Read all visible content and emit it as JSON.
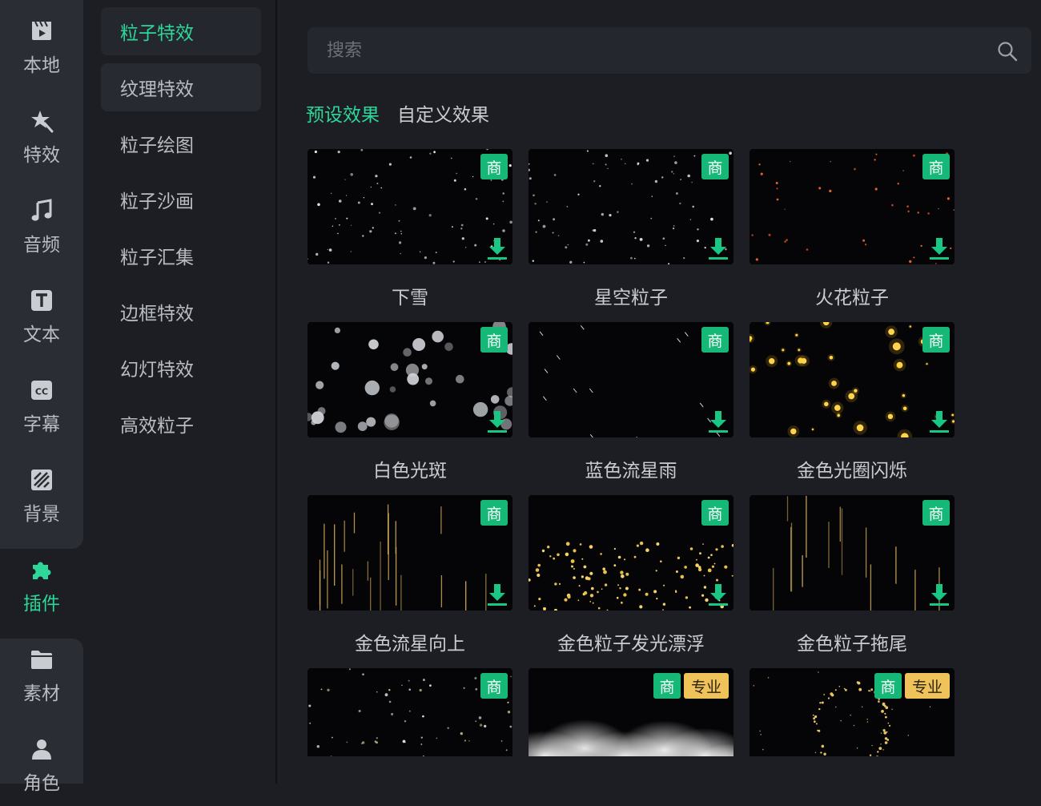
{
  "rail": {
    "items": [
      {
        "label": "本地",
        "icon": "film-clapper-icon"
      },
      {
        "label": "特效",
        "icon": "star-wand-icon"
      },
      {
        "label": "音频",
        "icon": "music-note-icon"
      },
      {
        "label": "文本",
        "icon": "text-t-icon"
      },
      {
        "label": "字幕",
        "icon": "cc-caption-icon"
      },
      {
        "label": "背景",
        "icon": "background-pattern-icon"
      },
      {
        "label": "插件",
        "icon": "puzzle-icon"
      },
      {
        "label": "素材",
        "icon": "folder-icon"
      },
      {
        "label": "角色",
        "icon": "person-icon"
      }
    ],
    "active_label": "插件",
    "accent": "#2ed69a"
  },
  "categories": [
    "粒子特效",
    "纹理特效",
    "粒子绘图",
    "粒子沙画",
    "粒子汇集",
    "边框特效",
    "幻灯特效",
    "高效粒子"
  ],
  "selected_category": "粒子特效",
  "search": {
    "placeholder": "搜索",
    "value": "",
    "icon": "search-icon"
  },
  "tabs": [
    {
      "label": "预设效果",
      "active": true
    },
    {
      "label": "自定义效果",
      "active": false
    }
  ],
  "badges": {
    "commercial": "商",
    "pro": "专业",
    "commercial_color": "#15b877",
    "pro_color": "#f0c25a"
  },
  "effects": [
    {
      "title": "下雪",
      "art": "snow",
      "badges": [
        "商"
      ]
    },
    {
      "title": "星空粒子",
      "art": "stars",
      "badges": [
        "商"
      ]
    },
    {
      "title": "火花粒子",
      "art": "sparks",
      "badges": [
        "商"
      ]
    },
    {
      "title": "白色光斑",
      "art": "bokeh",
      "badges": [
        "商"
      ]
    },
    {
      "title": "蓝色流星雨",
      "art": "meteor",
      "badges": [
        "商"
      ]
    },
    {
      "title": "金色光圈闪烁",
      "art": "gold-flash",
      "badges": [
        "商"
      ]
    },
    {
      "title": "金色流星向上",
      "art": "gold-lines",
      "badges": [
        "商"
      ]
    },
    {
      "title": "金色粒子发光漂浮",
      "art": "gold-float",
      "badges": [
        "商"
      ]
    },
    {
      "title": "金色粒子拖尾",
      "art": "gold-trail",
      "badges": [
        "商"
      ]
    },
    {
      "title": "",
      "art": "dust",
      "badges": [
        "商"
      ]
    },
    {
      "title": "",
      "art": "cloud",
      "badges": [
        "商",
        "专业"
      ]
    },
    {
      "title": "",
      "art": "ring",
      "badges": [
        "商",
        "专业"
      ]
    }
  ]
}
